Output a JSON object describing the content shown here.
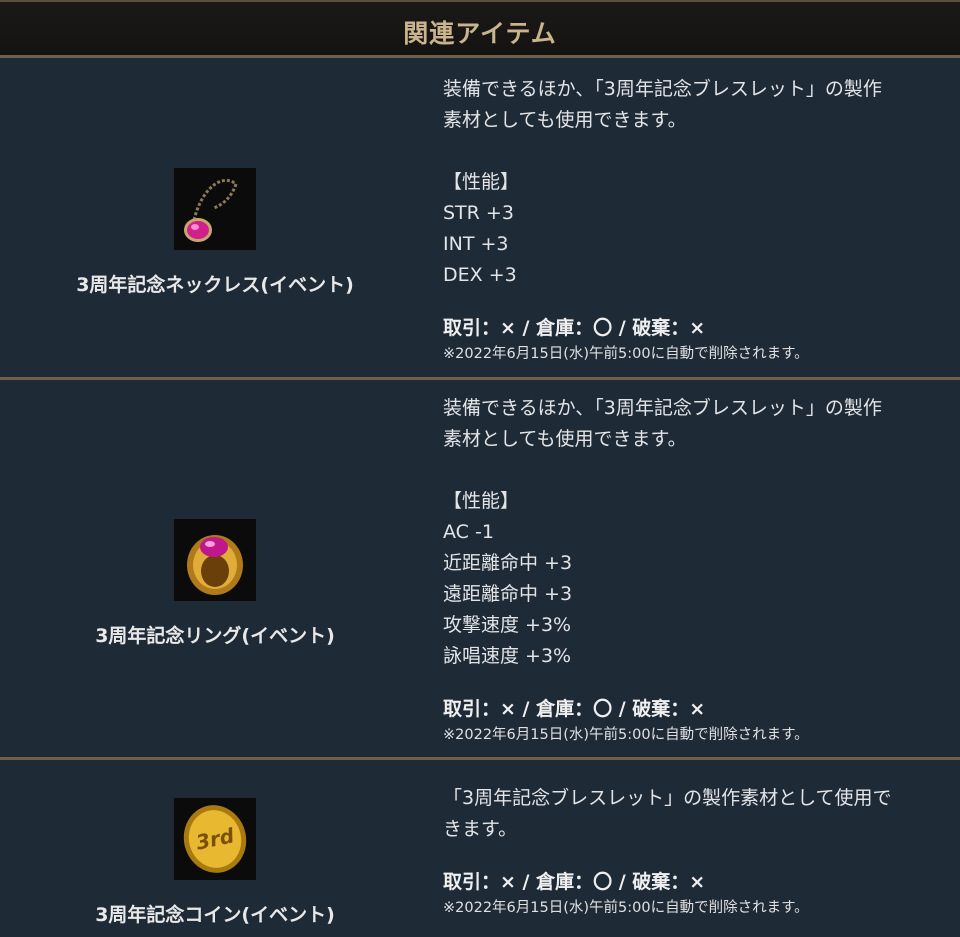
{
  "header": {
    "title": "関連アイテム"
  },
  "items": [
    {
      "name": "3周年記念ネックレス(イベント)",
      "icon": "necklace-icon",
      "desc_line1": "装備できるほか、「3周年記念ブレスレット」の製作",
      "desc_line2": "素材としても使用できます。",
      "stats_header": "【性能】",
      "stats": [
        "STR +3",
        "INT +3",
        "DEX +3"
      ],
      "trade": "取引：× / 倉庫：〇 / 破棄：×",
      "note": "※2022年6月15日(水)午前5:00に自動で削除されます。"
    },
    {
      "name": "3周年記念リング(イベント)",
      "icon": "ring-icon",
      "desc_line1": "装備できるほか、「3周年記念ブレスレット」の製作",
      "desc_line2": "素材としても使用できます。",
      "stats_header": "【性能】",
      "stats": [
        "AC -1",
        "近距離命中 +3",
        "遠距離命中 +3",
        "攻撃速度 +3%",
        "詠唱速度 +3%"
      ],
      "trade": "取引：× / 倉庫：〇 / 破棄：×",
      "note": "※2022年6月15日(水)午前5:00に自動で削除されます。"
    },
    {
      "name": "3周年記念コイン(イベント)",
      "icon": "coin-icon",
      "icon_text": "3rd",
      "desc_line1": "「3周年記念ブレスレット」の製作素材として使用で",
      "desc_line2": "きます。",
      "trade": "取引：× / 倉庫：〇 / 破棄：×",
      "note": "※2022年6月15日(水)午前5:00に自動で削除されます。"
    }
  ]
}
